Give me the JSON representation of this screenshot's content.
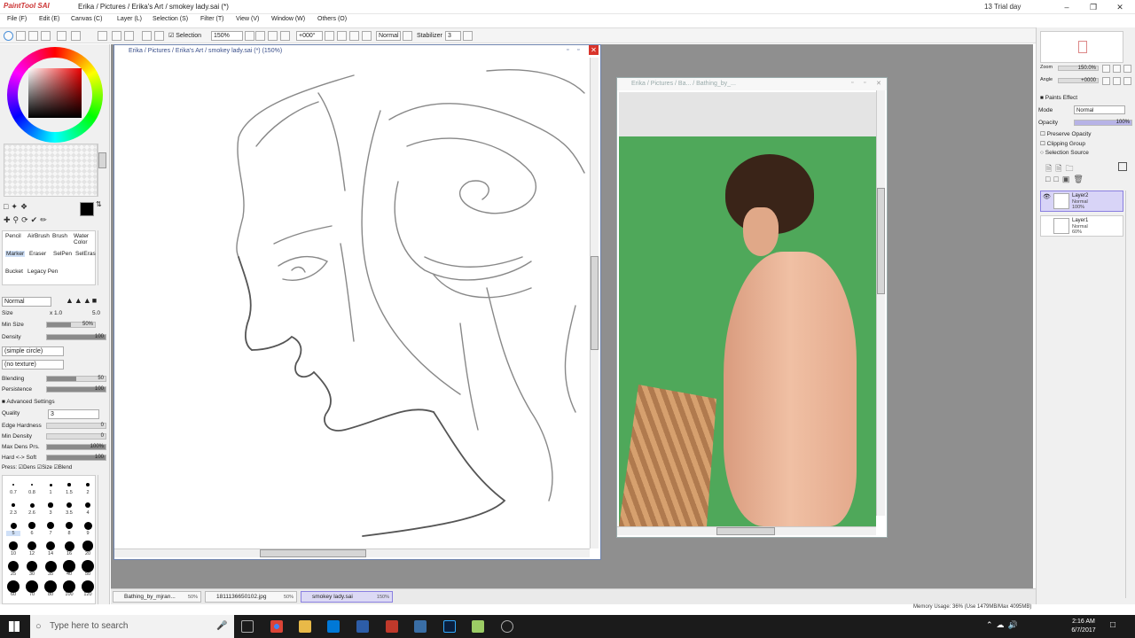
{
  "app": {
    "logo": "PaintTool SAI",
    "window_title": "Erika / Pictures / Erika's Art / smokey lady.sai (*)",
    "trial": "13 Trial day"
  },
  "menu": [
    "File (F)",
    "Edit (E)",
    "Canvas (C)",
    "Layer (L)",
    "Selection (S)",
    "Filter (T)",
    "View (V)",
    "Window (W)",
    "Others (O)"
  ],
  "toolbar": {
    "selection_label": "Selection",
    "zoom": "150%",
    "angle": "+000°",
    "mode": "Normal",
    "stabilizer_label": "Stabilizer",
    "stabilizer_value": "3"
  },
  "tools": {
    "row1": [
      "Pencil",
      "AirBrush",
      "Brush",
      "Water Color"
    ],
    "row2": [
      "Marker",
      "Eraser",
      "SelPen",
      "SelEras"
    ],
    "row3": [
      "Bucket",
      "Legacy Pen"
    ]
  },
  "brush": {
    "blend_mode": "Normal",
    "size_label": "Size",
    "size_mult": "x 1.0",
    "size_value": "5.0",
    "min_size_label": "Min Size",
    "min_size_value": "50%",
    "min_size_frac": 0.5,
    "density_label": "Density",
    "density_value": "100",
    "shape": "(simple circle)",
    "texture": "(no texture)",
    "blending_label": "Blending",
    "blending_value": "50",
    "persistence_label": "Persistence",
    "persistence_value": "100",
    "advanced_label": "Advanced Settings",
    "quality_label": "Quality",
    "quality_value": "3",
    "edge_hardness_label": "Edge Hardness",
    "edge_hardness_value": "0",
    "min_density_label": "Min Density",
    "min_density_value": "0",
    "max_dens_prs_label": "Max Dens Prs.",
    "max_dens_prs_value": "100%",
    "hard_soft_label": "Hard <-> Soft",
    "hard_soft_value": "100",
    "press_label": "Press:",
    "press_dens": "Dens",
    "press_size": "Size",
    "press_blend": "Blend",
    "size_presets": [
      "0.7",
      "0.8",
      "1",
      "1.5",
      "2",
      "2.3",
      "2.6",
      "3",
      "3.5",
      "4",
      "5",
      "6",
      "7",
      "8",
      "9",
      "10",
      "12",
      "14",
      "16",
      "20",
      "25",
      "30",
      "35",
      "40",
      "50",
      "60",
      "70",
      "80",
      "100",
      "120"
    ]
  },
  "documents": {
    "main_title": "Erika / Pictures / Erika's Art / smokey lady.sai (*) (150%)",
    "ref_title": "Erika / Pictures / Ba... / Bathing_by_...",
    "tabs": [
      {
        "name": "Bathing_by_mjran...",
        "zoom": "50%"
      },
      {
        "name": "1811136650102.jpg",
        "zoom": "50%"
      },
      {
        "name": "smokey lady.sai",
        "zoom": "150%"
      }
    ]
  },
  "navigator": {
    "zoom_label": "Zoom",
    "zoom_value": "150.0%",
    "angle_label": "Angle",
    "angle_value": "+0000"
  },
  "layer_panel": {
    "paints_effect": "Paints Effect",
    "mode_label": "Mode",
    "mode_value": "Normal",
    "opacity_label": "Opacity",
    "opacity_value": "100%",
    "preserve_opacity": "Preserve Opacity",
    "clipping_group": "Clipping Group",
    "selection_source": "Selection Source",
    "layers": [
      {
        "name": "Layer2",
        "mode": "Normal",
        "opacity": "100%",
        "selected": true
      },
      {
        "name": "Layer1",
        "mode": "Normal",
        "opacity": "60%",
        "selected": false
      }
    ]
  },
  "status": {
    "memory": "Memory Usage: 36% (Use 1479MB/Max 4095MB)"
  },
  "taskbar": {
    "search_placeholder": "Type here to search",
    "time": "2:16 AM",
    "date": "6/7/2017"
  },
  "colors": {
    "accent": "#8a80e0",
    "green_screen": "#4fa85a",
    "current_color": "#000000"
  }
}
